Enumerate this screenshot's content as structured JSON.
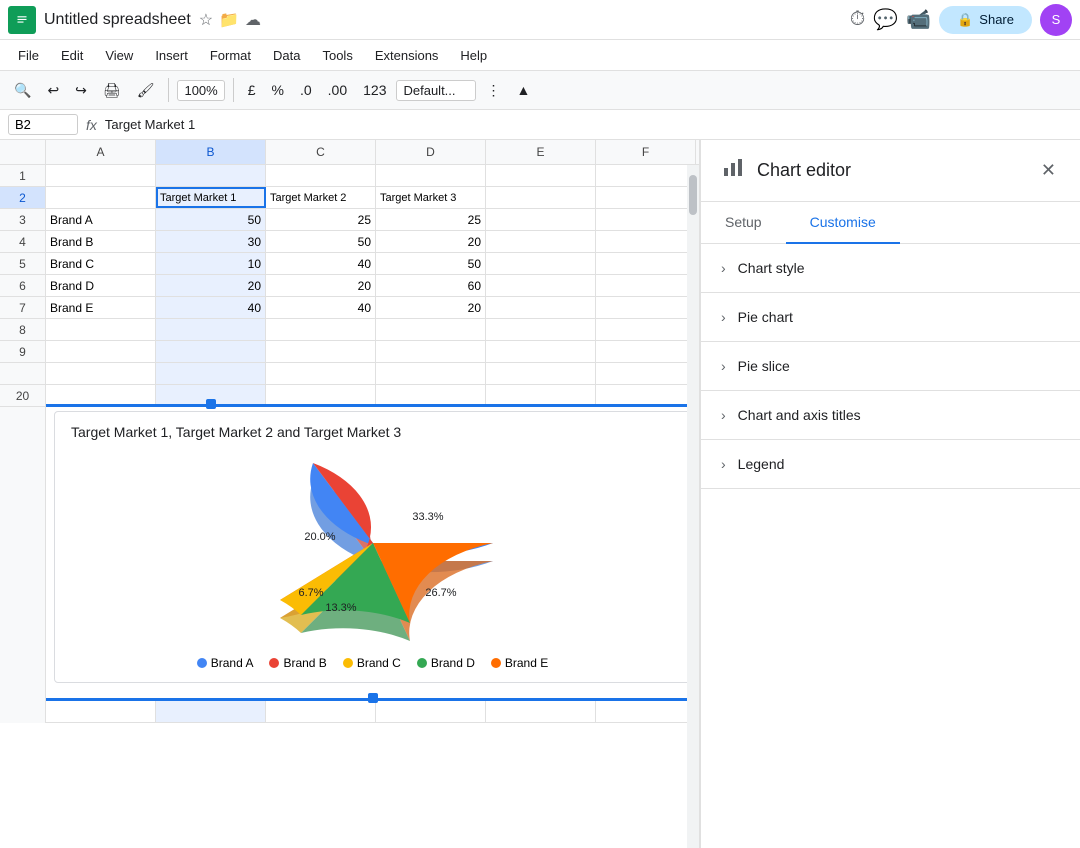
{
  "titleBar": {
    "appName": "Untitled spreadsheet",
    "shareLabel": "Share",
    "avatarInitial": "S",
    "avatarBg": "#a142f4"
  },
  "menuBar": {
    "items": [
      "File",
      "Edit",
      "View",
      "Insert",
      "Format",
      "Data",
      "Tools",
      "Extensions",
      "Help"
    ]
  },
  "toolbar": {
    "zoom": "100%",
    "fontFormat": "Default...",
    "currencySymbol": "£",
    "percentSymbol": "%"
  },
  "formulaBar": {
    "cellRef": "B2",
    "formula": "Target Market 1"
  },
  "spreadsheet": {
    "columns": [
      "A",
      "B",
      "C",
      "D",
      "E",
      "F"
    ],
    "rows": [
      {
        "rowNum": 1,
        "cells": [
          "",
          "",
          "",
          "",
          "",
          ""
        ]
      },
      {
        "rowNum": 2,
        "cells": [
          "",
          "Target Market 1",
          "Target Market 2",
          "Target Market 3",
          "",
          ""
        ],
        "isHeader": true
      },
      {
        "rowNum": 3,
        "cells": [
          "Brand A",
          "50",
          "25",
          "25",
          "",
          ""
        ]
      },
      {
        "rowNum": 4,
        "cells": [
          "Brand B",
          "30",
          "50",
          "20",
          "",
          ""
        ]
      },
      {
        "rowNum": 5,
        "cells": [
          "Brand C",
          "10",
          "40",
          "50",
          "",
          ""
        ]
      },
      {
        "rowNum": 6,
        "cells": [
          "Brand D",
          "20",
          "20",
          "60",
          "",
          ""
        ]
      },
      {
        "rowNum": 7,
        "cells": [
          "Brand E",
          "40",
          "40",
          "20",
          "",
          ""
        ]
      },
      {
        "rowNum": 8,
        "cells": [
          "",
          "",
          "",
          "",
          "",
          ""
        ]
      },
      {
        "rowNum": 9,
        "cells": [
          "",
          "",
          "",
          "",
          "",
          ""
        ]
      }
    ],
    "selectedCell": "B2"
  },
  "chart": {
    "title": "Target Market 1, Target Market 2 and Target Market 3",
    "type": "pie",
    "slices": [
      {
        "label": "Brand A",
        "value": 33.3,
        "color": "#4285f4",
        "angle": 120
      },
      {
        "label": "Brand B",
        "value": 20.0,
        "color": "#ea4335",
        "angle": 72
      },
      {
        "label": "Brand C",
        "value": 6.7,
        "color": "#fbbc04",
        "angle": 24
      },
      {
        "label": "Brand D",
        "value": 13.3,
        "color": "#34a853",
        "angle": 48
      },
      {
        "label": "Brand E",
        "value": 26.7,
        "color": "#ff6d00",
        "angle": 96
      }
    ],
    "labels": [
      {
        "brand": "Brand A",
        "pct": "33.3%",
        "color": "#4285f4"
      },
      {
        "brand": "Brand B",
        "pct": "20.0%",
        "color": "#ea4335"
      },
      {
        "brand": "Brand C",
        "pct": "6.7%",
        "color": "#fbbc04"
      },
      {
        "brand": "Brand D",
        "pct": "13.3%",
        "color": "#34a853"
      },
      {
        "brand": "Brand E",
        "pct": "26.7%",
        "color": "#ff6d00"
      }
    ]
  },
  "chartEditor": {
    "title": "Chart editor",
    "closeLabel": "✕",
    "tabs": [
      {
        "id": "setup",
        "label": "Setup"
      },
      {
        "id": "customise",
        "label": "Customise",
        "active": true
      }
    ],
    "sections": [
      {
        "id": "chart-style",
        "label": "Chart style"
      },
      {
        "id": "pie-chart",
        "label": "Pie chart"
      },
      {
        "id": "pie-slice",
        "label": "Pie slice"
      },
      {
        "id": "chart-axis-titles",
        "label": "Chart and axis titles"
      },
      {
        "id": "legend",
        "label": "Legend"
      }
    ]
  }
}
